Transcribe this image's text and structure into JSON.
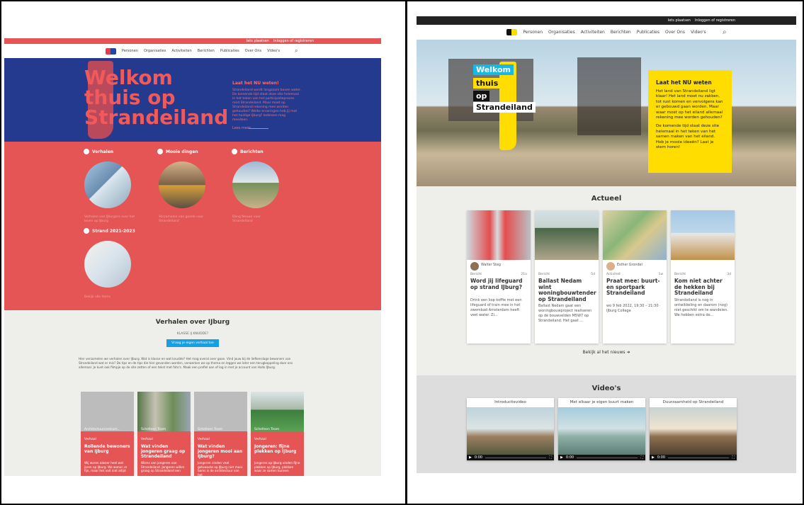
{
  "left_site": {
    "topbar_links": [
      "Iets plaatsen",
      "Inloggen of registreren"
    ],
    "nav": [
      "Personen",
      "Organisaties",
      "Activiteiten",
      "Berichten",
      "Publicaties",
      "Over Ons",
      "Video's"
    ],
    "hero_title": "Welkom thuis op Strandeiland",
    "side_title": "Laat het NU weten!",
    "side_text": "Strandeiland wordt langzaam boven water. De komende tijd staat deze site helemaal in het teken van het participatieproces rond Strandeiland. Maar moet op Strandeiland rekening mee worden gehouden? Welke ervaringen heb jij met het huidige IJburg? Iedereen mag meedoen.",
    "read_more": "Lees meer",
    "categories": [
      {
        "title": "Verhalen",
        "caption": "Verhalen van IJburgers over het leven op IJburg"
      },
      {
        "title": "Mooie dingen",
        "caption": "Verzamelen van goede voor Strandeiland"
      },
      {
        "title": "Berichten",
        "caption": "Dóng Neuws voor Strandeiland"
      },
      {
        "title": "Strand 2021-2023",
        "caption": "Bekijk alle items"
      }
    ],
    "stories_title": "Verhalen over IJburg",
    "stories_sub": "KLASSE IJ KNUDDE?",
    "stories_button": "Vraag je eigen verhaal toe",
    "stories_text": "Hier verzamelen we verhalen over IJburg. Wat is klasse en wat knudde? Het mag overal over gaan. Vind jouw bij de liefkenslage bewoners van Strandeiland wat er mis? De tips en de tips die hier gevonden worden, verwerken we op thema en leggen we later een terugkoppeling door ons allemaal. Je kunt ook filmpje op de site zetten of een tekst met foto's. Maak een profiel aan of log in met je account van Hallo IJburg.",
    "story_cards": [
      {
        "author": "Architectuurcentrum...",
        "type": "Verhaal",
        "title": "Rollende bewoners van IJburg",
        "text": "Wij waren alweer heel wat jaren op IJburg. We wonen er fijn, maar het valt niet altijd"
      },
      {
        "author": "Schelleen Team",
        "type": "Verhaal",
        "title": "Wat vinden jongeren graag op Strandeiland",
        "text": "Wiens van jongeren van Strandeiland. Jongeren willen graag op Strandeiland een"
      },
      {
        "author": "Schelleen Team",
        "type": "Verhaal",
        "title": "Wat vinden jongeren mooi aan IJburg?",
        "text": "Jongeren vinden veel getuwaste op IJburg niet mooi. Soms is de architectuur van het"
      },
      {
        "author": "Schelleen Team",
        "type": "Verhaal",
        "title": "Jongeren: fijne plekken op IJburg",
        "text": "Jongeren op IJburg vinden fijne plekken op IJburg, plekken waar ze samen kunnen"
      }
    ]
  },
  "right_site": {
    "topbar_links": [
      "Iets plaatsen",
      "Inloggen of registreren"
    ],
    "nav": [
      "Personen",
      "Organisaties",
      "Activiteiten",
      "Berichten",
      "Publicaties",
      "Over Ons",
      "Video's"
    ],
    "hero_words": [
      "Welkom",
      "thuis",
      "op",
      "Strandeiland"
    ],
    "info_title": "Laat het NU weten",
    "info_p1": "Het land van Strandeiland ligt klaar! Het land moet nu zakken, tot rust komen en vervolgens kan er gebouwd gaan worden. Maar waar moet op het eiland allemaal rekening mee worden gehouden?",
    "info_p2": "De komende tijd staat deze site helemaal in het teken van het samen maken van het eiland. Heb je mooie ideeën? Laat je stem horen!",
    "news_title": "Actueel",
    "news_cards": [
      {
        "author": "Walter Steg",
        "type": "Bericht",
        "date": "21u",
        "title": "Word jij lifeguard op strand IJburg?",
        "text": "Drink een kop koffie met een lifeguard of train mee in het zwembad Amsterdam heeft veel water. Zi..."
      },
      {
        "author": "",
        "type": "Bericht",
        "date": "5d",
        "title": "Ballast Nedam wint woningbouwtender op Strandeiland",
        "text": "Ballast Nedam gaat een woningbouwproject realiseren op de bouwvelden M5W7 op Strandeiland. Het gaat ..."
      },
      {
        "author": "Esther Grondel",
        "type": "Activiteit",
        "date": "1w",
        "title": "Praat mee: buurt- en sportpark Strandeiland",
        "text": "wo 9 feb 2022, 19:30 – 21:30 · IJburg College"
      },
      {
        "author": "",
        "type": "Bericht",
        "date": "3d",
        "title": "Kom niet achter de hekken bij Strandeiland",
        "text": "Strandeiland is nog in ontwikkeling en daarom (nog) niet geschikt om te wandelen. We hebben extra de..."
      }
    ],
    "news_more": "Bekijk al het nieuws",
    "videos_title": "Video's",
    "videos": [
      "Introductievideo",
      "Met elkaar je eigen buurt maken",
      "Duurzaamheid op Strandeiland"
    ],
    "video_time": "0:00"
  },
  "colors": {
    "red": "#e55555",
    "blue": "#243a8f",
    "yellow": "#ffdd00",
    "dark": "#222222",
    "lightgray": "#eeeeea"
  }
}
